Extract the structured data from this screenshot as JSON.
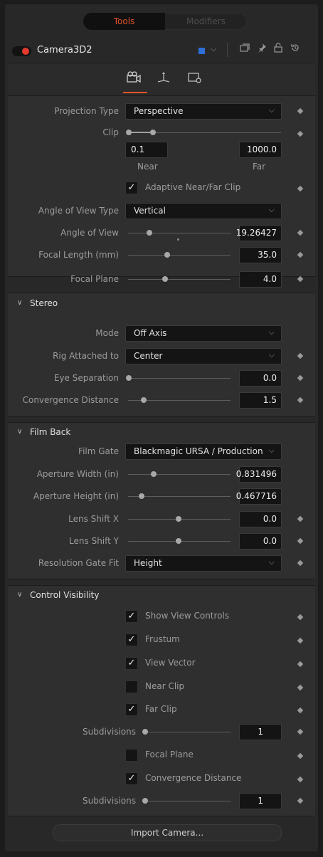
{
  "top_tabs": {
    "tools": "Tools",
    "modifiers": "Modifiers"
  },
  "tool": {
    "name": "Camera3D2",
    "color": "#2e6fd8"
  },
  "camera": {
    "projection_type": {
      "label": "Projection Type",
      "value": "Perspective"
    },
    "clip": {
      "label": "Clip",
      "near_value": "0.1",
      "far_value": "1000.0",
      "near_label": "Near",
      "far_label": "Far"
    },
    "adaptive_clip": {
      "label": "Adaptive Near/Far Clip",
      "checked": true
    },
    "aov_type": {
      "label": "Angle of View Type",
      "value": "Vertical"
    },
    "angle_of_view": {
      "label": "Angle of View",
      "value": "19.26427"
    },
    "focal_length": {
      "label": "Focal Length (mm)",
      "value": "35.0"
    },
    "focal_plane": {
      "label": "Focal Plane",
      "value": "4.0"
    }
  },
  "stereo": {
    "title": "Stereo",
    "mode": {
      "label": "Mode",
      "value": "Off Axis"
    },
    "rig_attached": {
      "label": "Rig Attached to",
      "value": "Center"
    },
    "eye_separation": {
      "label": "Eye Separation",
      "value": "0.0"
    },
    "convergence_distance": {
      "label": "Convergence Distance",
      "value": "1.5"
    }
  },
  "film_back": {
    "title": "Film Back",
    "film_gate": {
      "label": "Film Gate",
      "value": "Blackmagic URSA / Production"
    },
    "aperture_width": {
      "label": "Aperture Width (in)",
      "value": "0.831496"
    },
    "aperture_height": {
      "label": "Aperture Height (in)",
      "value": "0.467716"
    },
    "lens_shift_x": {
      "label": "Lens Shift X",
      "value": "0.0"
    },
    "lens_shift_y": {
      "label": "Lens Shift Y",
      "value": "0.0"
    },
    "resolution_gate_fit": {
      "label": "Resolution Gate Fit",
      "value": "Height"
    }
  },
  "control_visibility": {
    "title": "Control Visibility",
    "show_view_controls": {
      "label": "Show View Controls",
      "checked": true
    },
    "frustum": {
      "label": "Frustum",
      "checked": true
    },
    "view_vector": {
      "label": "View Vector",
      "checked": true
    },
    "near_clip": {
      "label": "Near Clip",
      "checked": false
    },
    "far_clip": {
      "label": "Far Clip",
      "checked": true
    },
    "subdivisions_1": {
      "label": "Subdivisions",
      "value": "1"
    },
    "focal_plane": {
      "label": "Focal Plane",
      "checked": false
    },
    "convergence_distance": {
      "label": "Convergence Distance",
      "checked": true
    },
    "subdivisions_2": {
      "label": "Subdivisions",
      "value": "1"
    }
  },
  "import_button": "Import Camera...",
  "glyphs": {
    "check": "✓",
    "chevron_down": "⌵",
    "section_chevron": "∨"
  }
}
